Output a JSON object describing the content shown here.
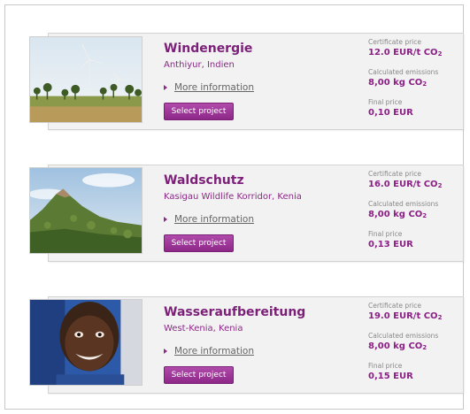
{
  "projects": [
    {
      "title": "Windenergie",
      "location": "Anthiyur, Indien",
      "more_info": "More information",
      "select_label": "Select project",
      "cert_price_label": "Certificate price",
      "cert_price_value": "12.0 EUR/t CO",
      "emissions_label": "Calculated emissions",
      "emissions_value": "8,00 kg CO",
      "final_label": "Final price",
      "final_value": "0,10 EUR",
      "subscript": "2",
      "image": "wind-turbines-photo"
    },
    {
      "title": "Waldschutz",
      "location": "Kasigau Wildlife Korridor, Kenia",
      "more_info": "More information",
      "select_label": "Select project",
      "cert_price_label": "Certificate price",
      "cert_price_value": "16.0 EUR/t CO",
      "emissions_label": "Calculated emissions",
      "emissions_value": "8,00 kg CO",
      "final_label": "Final price",
      "final_value": "0,13 EUR",
      "subscript": "2",
      "image": "forest-hill-photo"
    },
    {
      "title": "Wasseraufbereitung",
      "location": "West-Kenia, Kenia",
      "more_info": "More information",
      "select_label": "Select project",
      "cert_price_label": "Certificate price",
      "cert_price_value": "19.0 EUR/t CO",
      "emissions_label": "Calculated emissions",
      "emissions_value": "8,00 kg CO",
      "final_label": "Final price",
      "final_value": "0,15 EUR",
      "subscript": "2",
      "image": "smiling-child-photo"
    }
  ],
  "colors": {
    "accent": "#7c1f78",
    "button": "#9b3596",
    "card_bg": "#f2f2f2"
  }
}
